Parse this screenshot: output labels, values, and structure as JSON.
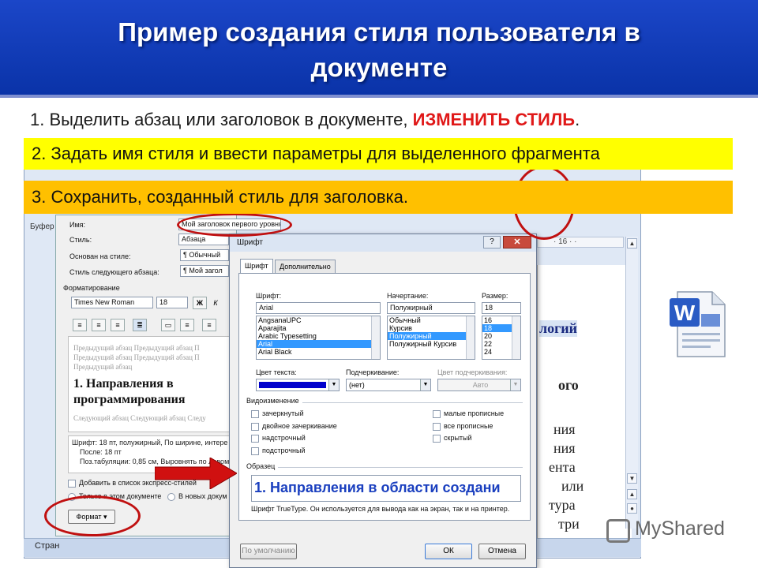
{
  "slide": {
    "title_line1": "Пример создания стиля пользователя в",
    "title_line2": "документе",
    "step1_prefix": "1.  Выделить абзац или заголовок в документе, ",
    "step1_highlight": "ИЗМЕНИТЬ СТИЛЬ",
    "step1_suffix": ".",
    "step2": "2. Задать имя стиля и ввести параметры для выделенного фрагмента",
    "step3": "3. Сохранить, созданный стиль для заголовка."
  },
  "word": {
    "ribbon_label": "Буфер",
    "ruler_text": "· 16 · ·",
    "doc_lines": [
      "логий",
      "ого",
      "ния",
      "ния",
      "ента",
      "или",
      "тура",
      "три"
    ],
    "status_left": "Стран",
    "watermark": "MyShared"
  },
  "modify_dialog": {
    "name_label": "Имя:",
    "name_value": "Мой заголовок первого уровня",
    "style_label": "Стиль:",
    "style_value": "Абзаца",
    "based_on_label": "Основан на стиле:",
    "based_on_value": "¶ Обычный",
    "next_style_label": "Стиль следующего абзаца:",
    "next_style_value": "¶ Мой загол",
    "formatting_label": "Форматирование",
    "font_value": "Times New Roman",
    "size_value": "18",
    "bold_label": "Ж",
    "italic_label": "К",
    "preview_before": "Предыдущий абзац Предыдущий абзац П Предыдущий абзац Предыдущий абзац П Предыдущий абзац",
    "preview_heading_1": "1.   Направления    в",
    "preview_heading_2": "программирования",
    "preview_after": "Следующий абзац Следующий абзац Следу",
    "description_1": "Шрифт: 18 пт, полужирный, По ширине, интере",
    "description_2": "После:  18 пт",
    "description_3": "Поз.табуляции:  0,85 см, Выровнять по левом",
    "add_to_quick": "Добавить в список экспресс-стилей",
    "only_doc": "Только в этом документе",
    "new_docs": "В новых докум",
    "format_button": "Формат ▾"
  },
  "font_dialog": {
    "title": "Шрифт",
    "help": "?",
    "close": "✕",
    "tab_font": "Шрифт",
    "tab_advanced": "Дополнительно",
    "font_label": "Шрифт:",
    "font_value": "Arial",
    "font_list": [
      "AngsanaUPC",
      "Aparajita",
      "Arabic Typesetting",
      "Arial",
      "Arial Black"
    ],
    "font_selected_index": 3,
    "style_label": "Начертание:",
    "style_value": "Полужирный",
    "style_list": [
      "Обычный",
      "Курсив",
      "Полужирный",
      "Полужирный Курсив"
    ],
    "style_selected_index": 2,
    "size_label": "Размер:",
    "size_value": "18",
    "size_list": [
      "16",
      "18",
      "20",
      "22",
      "24"
    ],
    "size_selected_index": 1,
    "text_color_label": "Цвет текста:",
    "text_color": "#0000cc",
    "underline_label": "Подчеркивание:",
    "underline_value": "(нет)",
    "underline_color_label": "Цвет подчеркивания:",
    "underline_color_value": "Авто",
    "effects_label": "Видоизменение",
    "effects_left": [
      "зачеркнутый",
      "двойное зачеркивание",
      "надстрочный",
      "подстрочный"
    ],
    "effects_right": [
      "малые прописные",
      "все прописные",
      "скрытый"
    ],
    "sample_label": "Образец",
    "sample_text": "1. Направления в области создани",
    "sample_note": "Шрифт TrueType. Он используется для вывода как на экран, так и на принтер.",
    "default_button": "По умолчанию",
    "ok_button": "ОК",
    "cancel_button": "Отмена"
  },
  "colors": {
    "header": "#0a33a8",
    "step2_bg": "#ffff00",
    "step3_bg": "#ffc000",
    "highlight": "#e01818",
    "annotation": "#c01010"
  }
}
